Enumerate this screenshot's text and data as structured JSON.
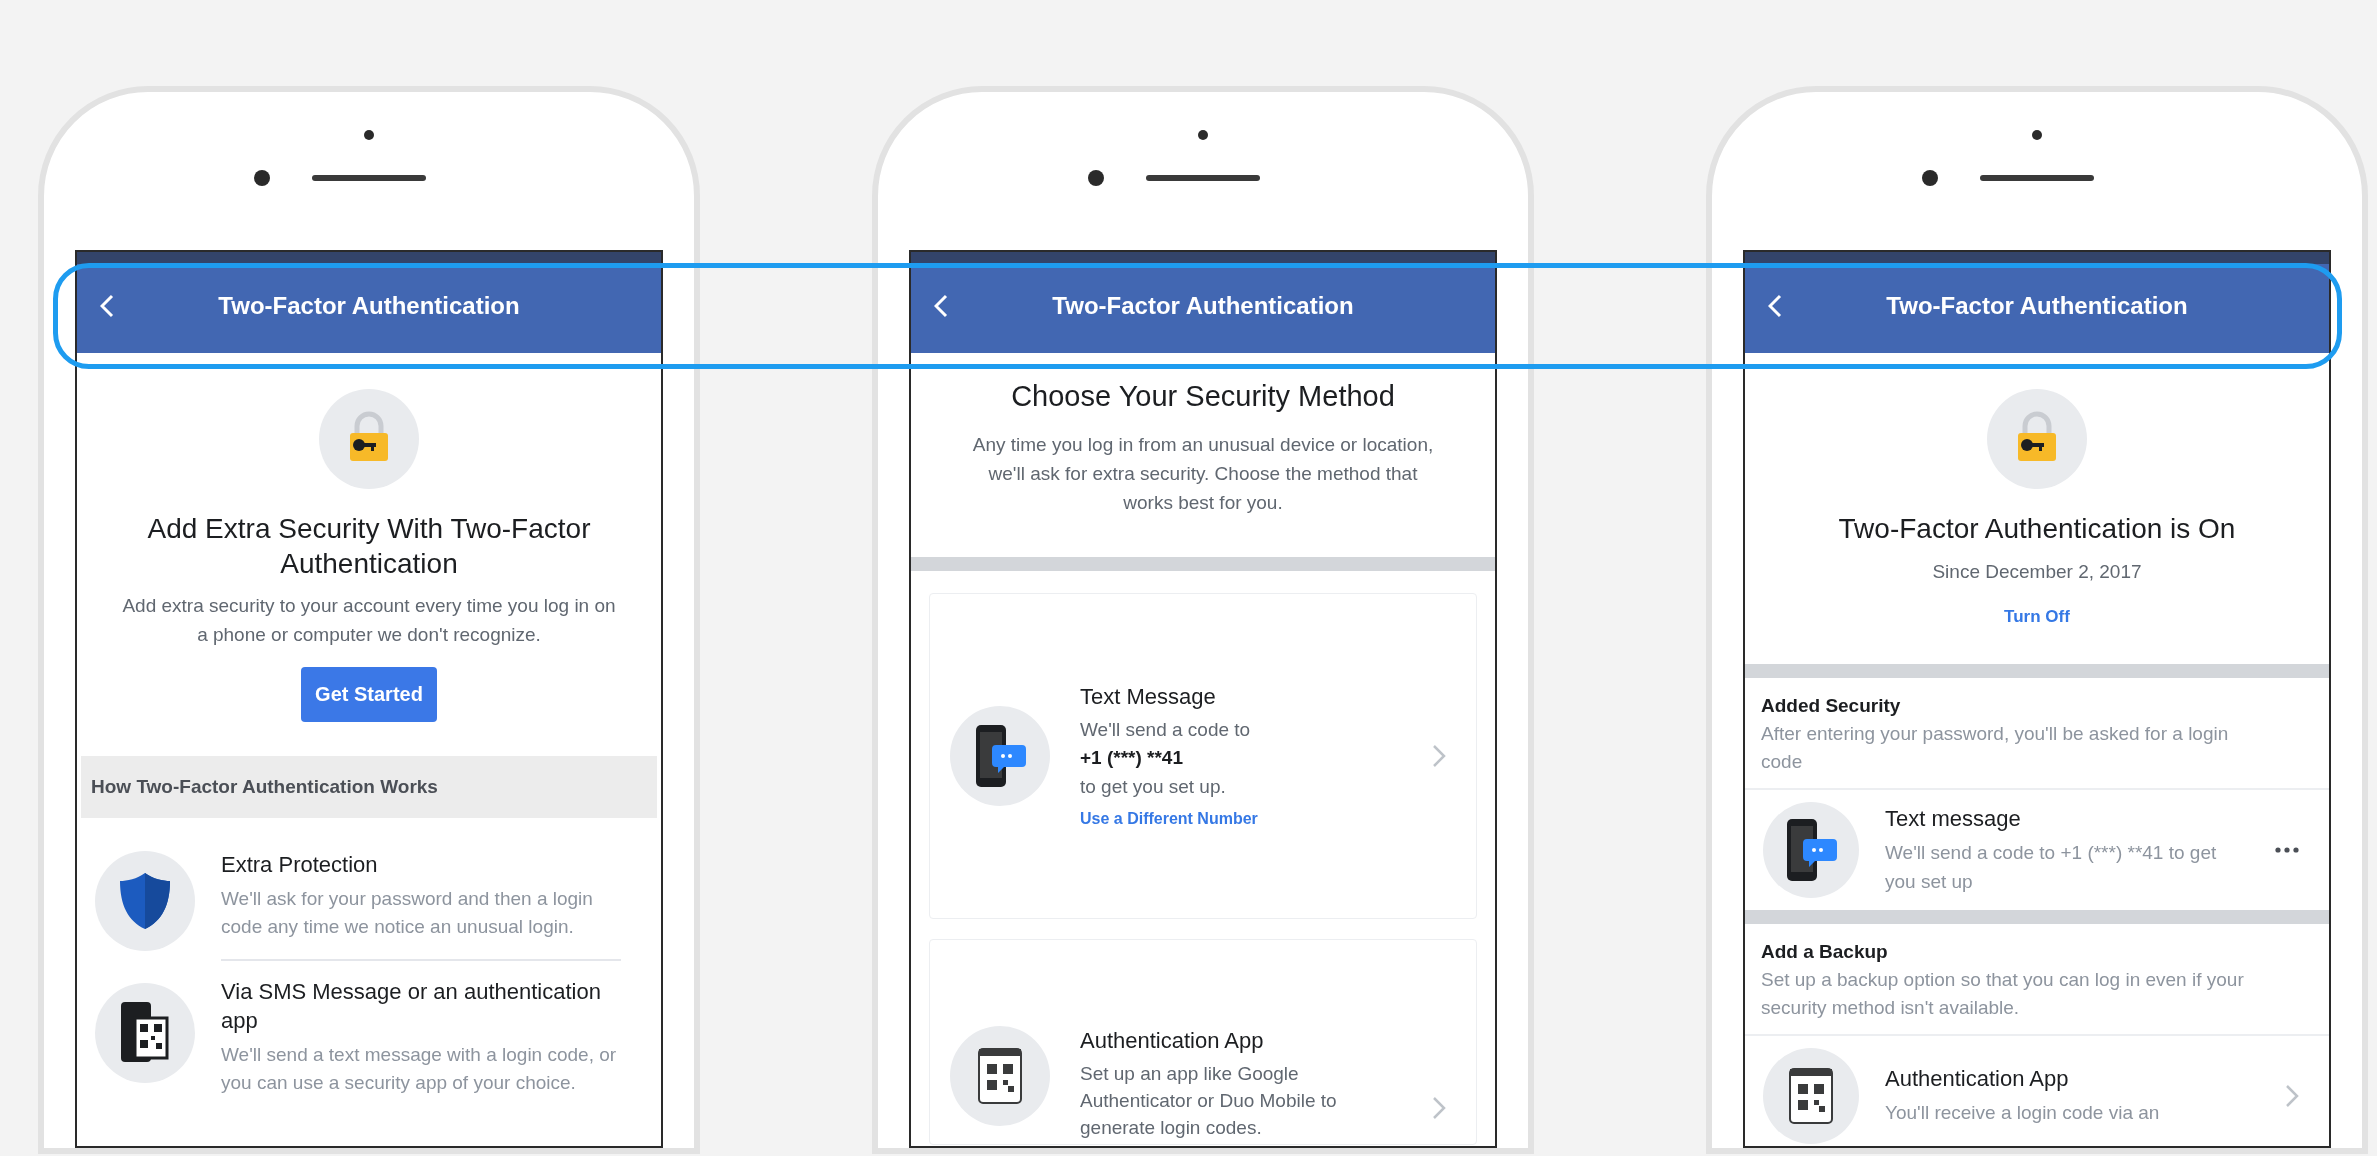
{
  "phones": [
    {
      "header": {
        "title": "Two-Factor Authentication"
      },
      "blocks": [
        {
          "kind": "hero",
          "title": "Add Extra Security With Two-Factor Authentication",
          "text": "Add extra security to your account every time you log in on a phone or computer we don't recognize.",
          "button": "Get Started"
        },
        {
          "kind": "section_header",
          "title": "How Two-Factor Authentication Works"
        },
        {
          "kind": "feature",
          "title": "Extra Protection",
          "text": "We'll ask for your password and then a login code any time we notice an unusual login."
        },
        {
          "kind": "feature",
          "title": "Via SMS Message or an authentication app",
          "text": "We'll send a text message with a login code, or you can use a security app of your choice."
        }
      ]
    },
    {
      "header": {
        "title": "Two-Factor Authentication"
      },
      "blocks": [
        {
          "kind": "intro",
          "title": "Choose Your Security Method",
          "text": "Any time you log in from an unusual device or location, we'll ask for extra security. Choose the method that works best for you."
        },
        {
          "kind": "method_card",
          "title": "Text Message",
          "text": "We'll send a code to",
          "number": "+1 (***) **41",
          "text_end": "to get you set up.",
          "link": "Use a Different Number"
        },
        {
          "kind": "method_card",
          "title": "Authentication App",
          "text": "Set up an app like Google Authenticator or Duo Mobile to generate login codes."
        }
      ]
    },
    {
      "header": {
        "title": "Two-Factor Authentication"
      },
      "blocks": [
        {
          "kind": "status",
          "title": "Two-Factor Authentication is On",
          "subtitle": "Since December 2, 2017",
          "link": "Turn Off"
        },
        {
          "kind": "info",
          "title": "Added Security",
          "text": "After entering your password, you'll be asked for a login code"
        },
        {
          "kind": "method_row",
          "title": "Text message",
          "text": "We'll send a code to +1 (***) **41 to get you set up",
          "trailing": {
            "kind": "more"
          }
        },
        {
          "kind": "info",
          "title": "Add a Backup",
          "text": "Set up a backup option so that you can log in even if your security method isn't available."
        },
        {
          "kind": "method_row",
          "title": "Authentication App",
          "text": "You'll receive a login code via an",
          "trailing": {
            "kind": "chevron"
          }
        }
      ]
    }
  ]
}
